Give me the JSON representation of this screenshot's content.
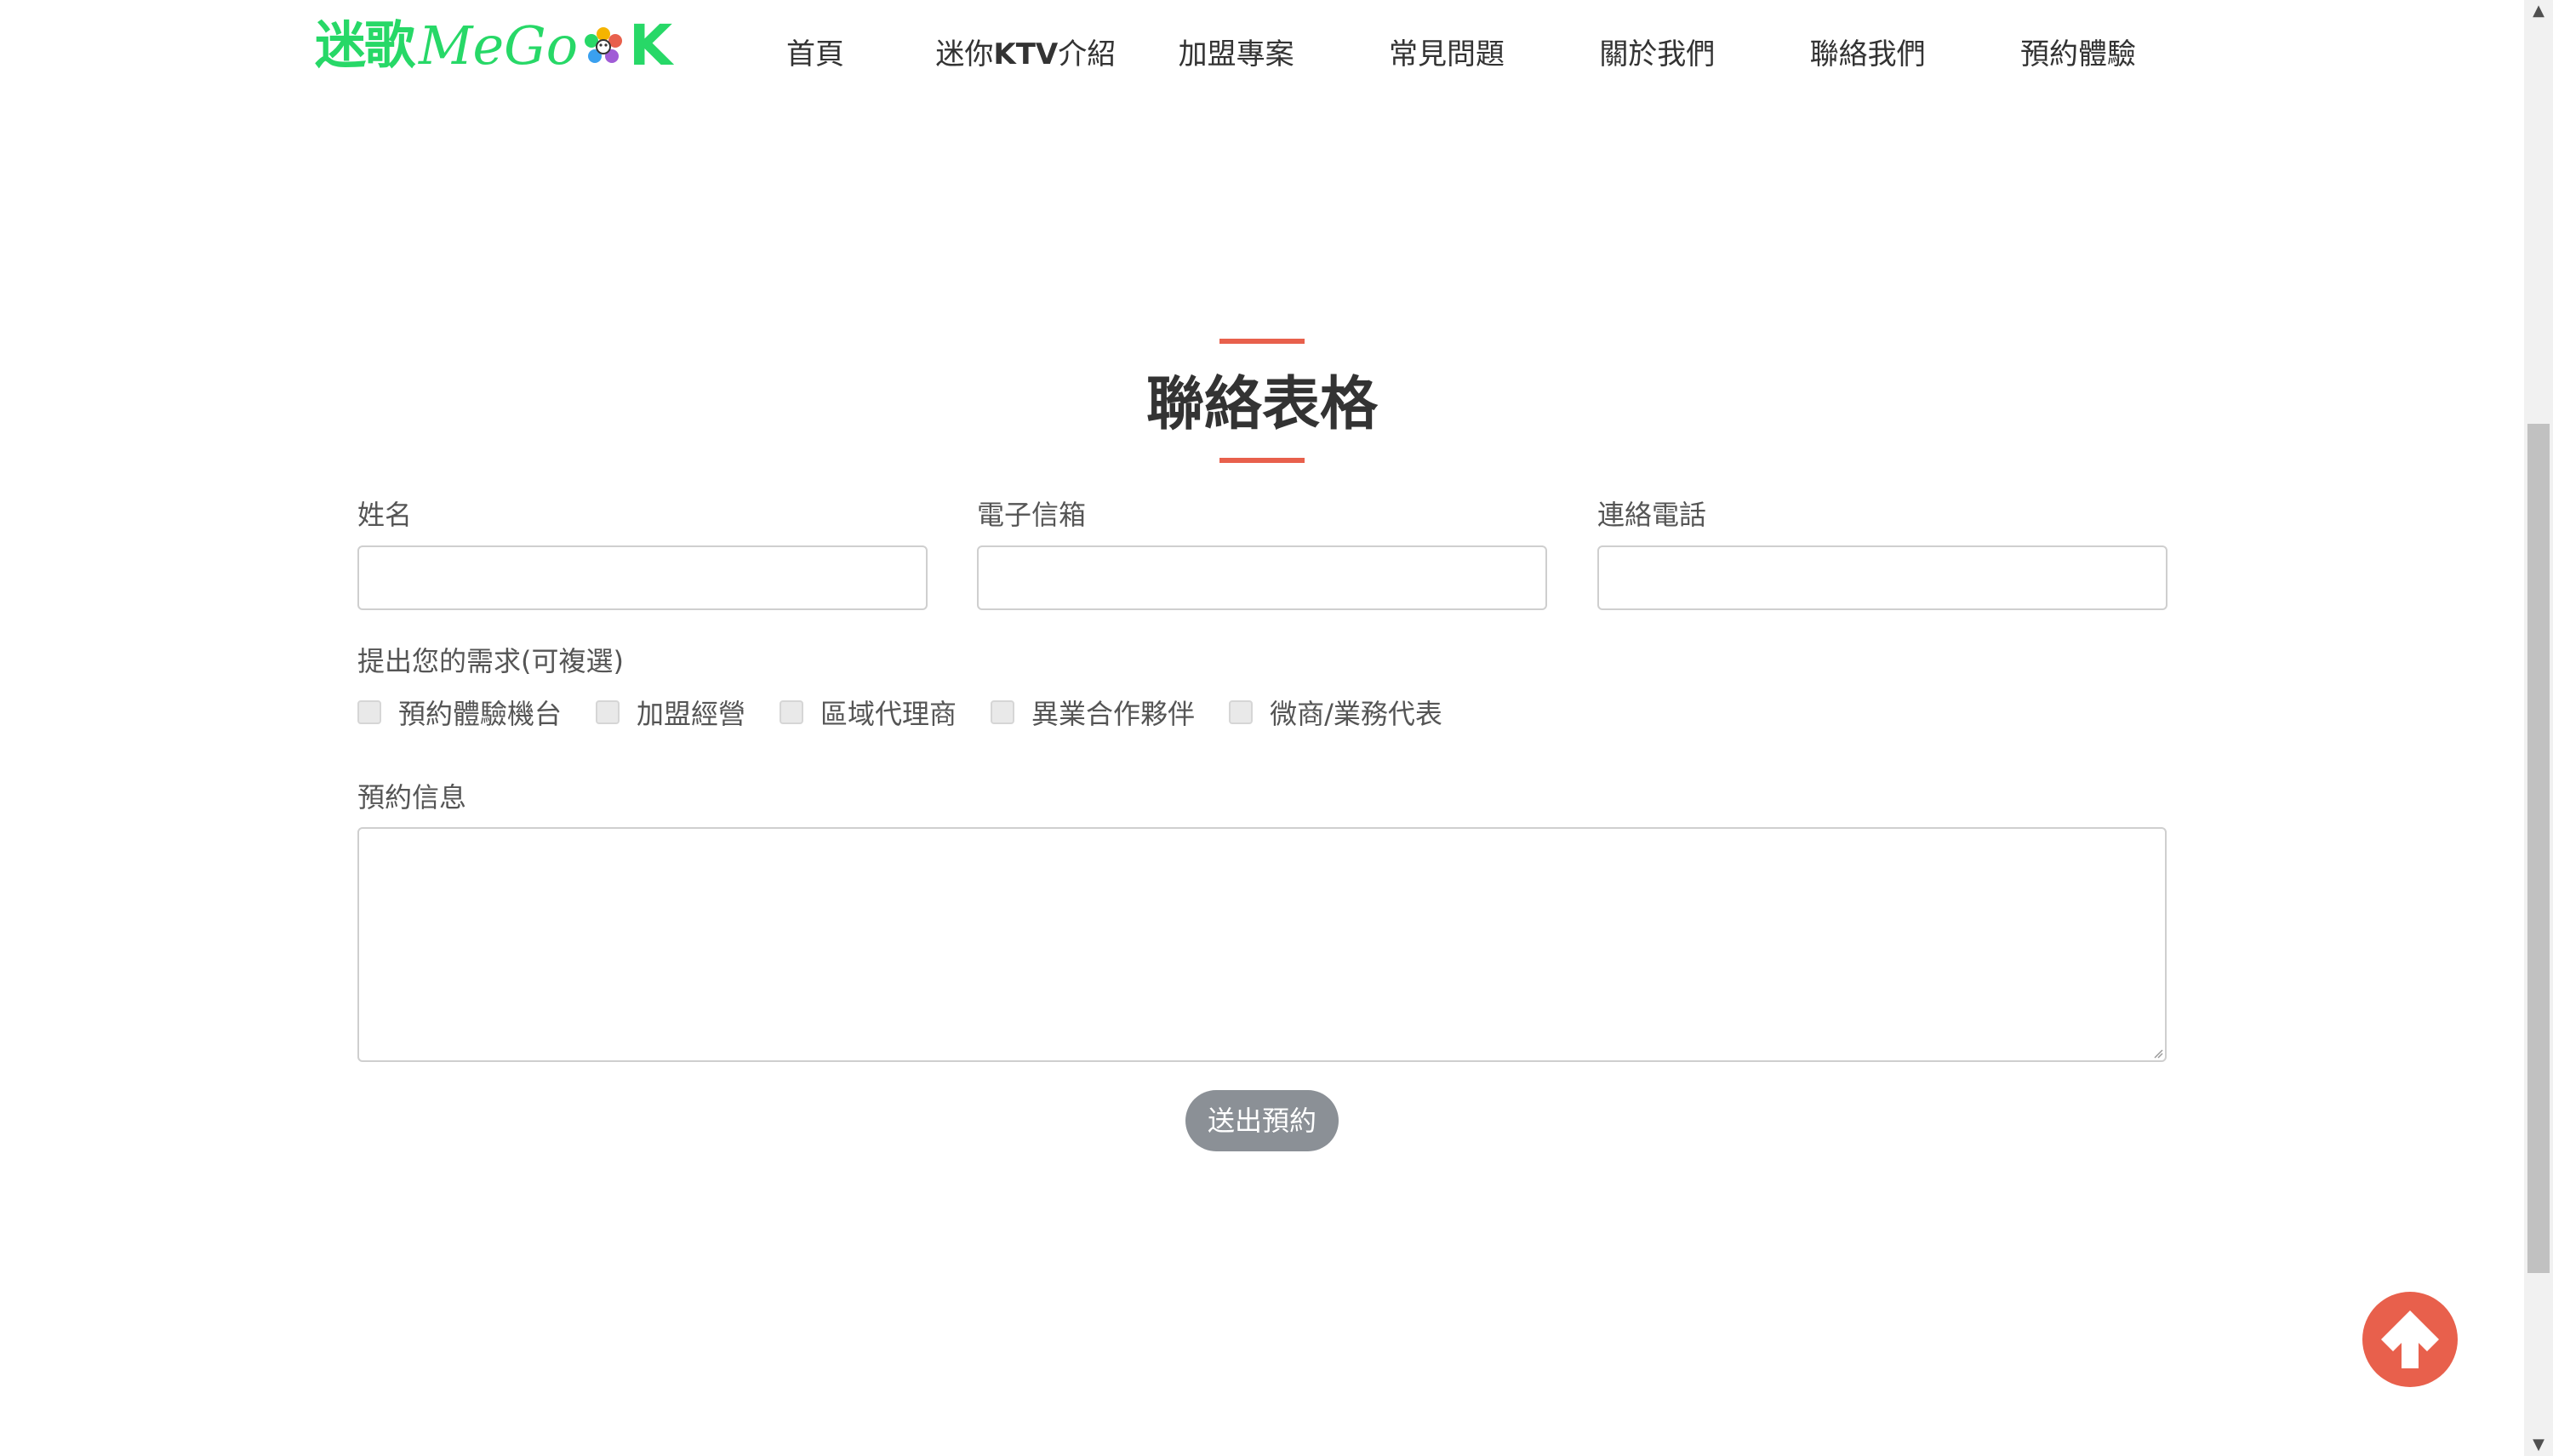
{
  "header": {
    "logo": {
      "chinese": "迷歌",
      "latin": "MeGo",
      "k": "K"
    },
    "nav": [
      {
        "label": "首頁"
      },
      {
        "prefix": "迷你",
        "bold": "KTV",
        "suffix": "介紹"
      },
      {
        "label": "加盟專案"
      },
      {
        "label": "常見問題"
      },
      {
        "label": "關於我們"
      },
      {
        "label": "聯絡我們"
      },
      {
        "label": "預約體驗"
      }
    ]
  },
  "section": {
    "title": "聯絡表格"
  },
  "form": {
    "name_label": "姓名",
    "name_value": "",
    "email_label": "電子信箱",
    "email_value": "",
    "phone_label": "連絡電話",
    "phone_value": "",
    "needs_label": "提出您的需求(可複選)",
    "options": [
      {
        "label": "預約體驗機台",
        "checked": false
      },
      {
        "label": "加盟經營",
        "checked": false
      },
      {
        "label": "區域代理商",
        "checked": false
      },
      {
        "label": "異業合作夥伴",
        "checked": false
      },
      {
        "label": "微商/業務代表",
        "checked": false
      }
    ],
    "message_label": "預約信息",
    "message_value": "",
    "submit_label": "送出預約"
  },
  "icons": {
    "back_to_top": "arrow-up-icon",
    "logo_flower": "flower-icon"
  },
  "colors": {
    "brand_green": "#27d867",
    "accent": "#e8604c",
    "submit_bg": "#8b9096"
  }
}
